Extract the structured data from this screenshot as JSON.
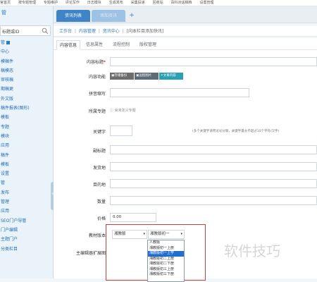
{
  "topnav": [
    "官首页",
    "按专题管理",
    "专题维护",
    "评论写作",
    "日志模块",
    "生成发布",
    "采集投递",
    "回收站",
    "百科对话稿档",
    "设置管理"
  ],
  "sidebar": {
    "title": "管",
    "search_value": "标题或ID",
    "items": [
      "管",
      "中心",
      "模稿件",
      "稿模态",
      "审核稿",
      "期稿更",
      "外文版",
      "稿件报表(图形)",
      "模板",
      "专题",
      "模块",
      "应用",
      "稿件",
      "模板",
      "设置",
      "管",
      "发布",
      "管理",
      "应用",
      "SEO门户导管",
      "门户编辑",
      "主题门户",
      "分类栏目"
    ]
  },
  "tabs": {
    "tab1": "资讯列表",
    "tab2": "添加资讯",
    "add": "+"
  },
  "breadcrumb": {
    "home": "工作台",
    "sep": "|",
    "l2": "内容管理",
    "l3": "资讯中心",
    "current": "[向本栏目添加快讯]"
  },
  "inner_tabs": [
    "内容信息",
    "信息属性",
    "流程控制",
    "版权管理"
  ],
  "form": {
    "title_label": "内容标题",
    "required_mark": "*",
    "func_label": "内容功能",
    "func_buttons": [
      "存储备份",
      "远程图片",
      "文章内容"
    ],
    "pinyin_label": "拼音缩写",
    "special_label": "所属专题",
    "special_hint": "尚未定义专题",
    "keyword_label": "关键字",
    "keyword_hint": "(多个关键字请用逗号分隔，关键字最长不超过10个字符/汉字)",
    "subtitle_label": "副标题",
    "origin_label": "发货地",
    "dest_label": "目的地",
    "qty_label": "数量",
    "price_label": "价格",
    "price_value": "0.00",
    "textbook_label": "教材版本",
    "textbook_select": "湘教版",
    "grade_select": "湘教版初一",
    "ext_label": "主编辑器扩展图"
  },
  "dropdown_options": [
    "人教版",
    "湘教版初一上册",
    "湘教版初一上学",
    "湘教版初二上册",
    "湘教版初二下册",
    "湘教版初三上册",
    "湘教版初三下册"
  ],
  "dropdown_selected_index": 2,
  "watermark": "软件技巧",
  "colors": {
    "accent": "#3e84c6",
    "sidebar_bg": "#eaf2fa",
    "highlight": "#1e6fd1",
    "red_box": "#c94238"
  }
}
